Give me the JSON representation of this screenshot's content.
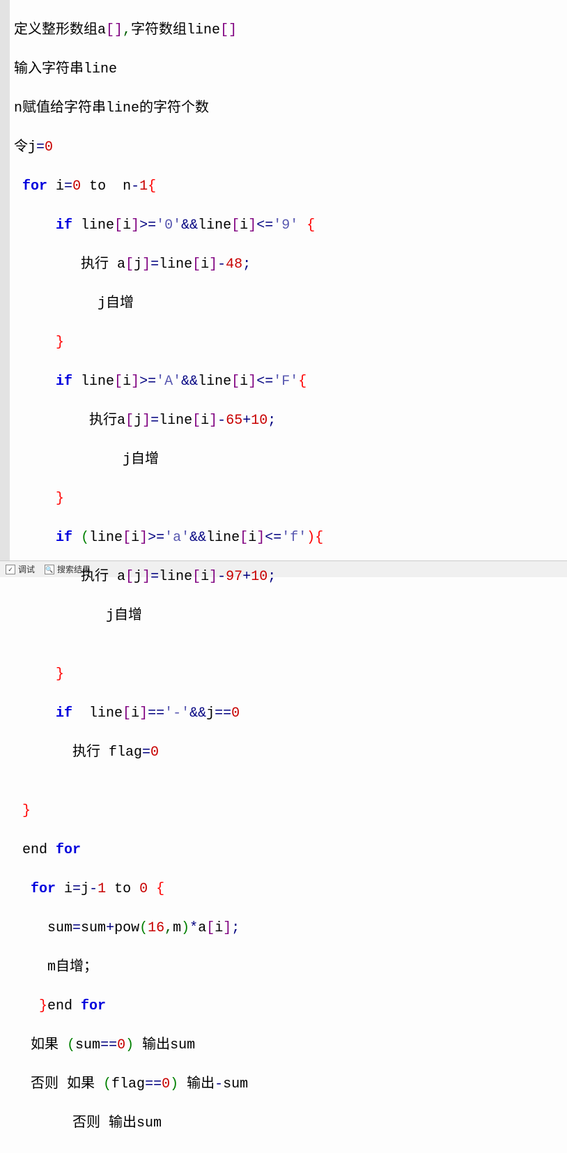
{
  "lines": {
    "l1": {
      "a": "定义整形数组a",
      "b": ",",
      "c": "字符数组line"
    },
    "l2": {
      "a": "输入字符串line"
    },
    "l3": {
      "a": "n赋值给字符串line的字符个数"
    },
    "l4": {
      "a": "令j",
      "b": "=",
      "c": "0"
    },
    "l5": {
      "a": "for",
      "b": " i",
      "c": "=",
      "d": "0",
      "e": " to  n",
      "f": "-",
      "g": "1",
      "h": "{"
    },
    "l6": {
      "a": "if",
      "b": " line",
      "c": "[",
      "d": "i",
      "e": "]",
      "f": ">=",
      "g": "'0'",
      "h": "&&",
      "i": "line",
      "j": "[",
      "k": "i",
      "l": "]",
      "m": "<=",
      "n": "'9'",
      "o": " {"
    },
    "l7": {
      "a": "执行 a",
      "b": "[",
      "c": "j",
      "d": "]",
      "e": "=",
      "f": "line",
      "g": "[",
      "h": "i",
      "i": "]",
      "j": "-",
      "k": "48",
      "l": ";"
    },
    "l8": {
      "a": "j自增"
    },
    "l9": {
      "a": "}"
    },
    "l10": {
      "a": "if",
      "b": " line",
      "c": "[",
      "d": "i",
      "e": "]",
      "f": ">=",
      "g": "'A'",
      "h": "&&",
      "i": "line",
      "j": "[",
      "k": "i",
      "l": "]",
      "m": "<=",
      "n": "'F'",
      "o": "{"
    },
    "l11": {
      "a": "执行a",
      "b": "[",
      "c": "j",
      "d": "]",
      "e": "=",
      "f": "line",
      "g": "[",
      "h": "i",
      "i": "]",
      "j": "-",
      "k": "65",
      "l": "+",
      "m": "10",
      "n": ";"
    },
    "l12": {
      "a": "j自增"
    },
    "l13": {
      "a": "}"
    },
    "l14": {
      "a": "if",
      "b": " (",
      "c": "line",
      "d": "[",
      "e": "i",
      "f": "]",
      "g": ">=",
      "h": "'a'",
      "i": "&&",
      "j": "line",
      "k": "[",
      "l": "i",
      "m": "]",
      "n": "<=",
      "o": "'f'",
      "p": "){"
    },
    "l15": {
      "a": "执行 a",
      "b": "[",
      "c": "j",
      "d": "]",
      "e": "=",
      "f": "line",
      "g": "[",
      "h": "i",
      "i": "]",
      "j": "-",
      "k": "97",
      "l": "+",
      "m": "10",
      "n": ";"
    },
    "l16": {
      "a": "j自增"
    },
    "l17": {
      "a": ""
    },
    "l18": {
      "a": "}"
    },
    "l19": {
      "a": "if",
      "b": "  line",
      "c": "[",
      "d": "i",
      "e": "]",
      "f": "==",
      "g": "'-'",
      "h": "&&",
      "i": "j",
      "j": "==",
      "k": "0"
    },
    "l20": {
      "a": "执行 flag",
      "b": "=",
      "c": "0"
    },
    "l21": {
      "a": ""
    },
    "l22": {
      "a": "}"
    },
    "l23": {
      "a": "end ",
      "b": "for"
    },
    "l24": {
      "a": "for",
      "b": " i",
      "c": "=",
      "d": "j",
      "e": "-",
      "f": "1",
      "g": " to ",
      "h": "0",
      "i": " {"
    },
    "l25": {
      "a": "sum",
      "b": "=",
      "c": "sum",
      "d": "+",
      "e": "pow",
      "f": "(",
      "g": "16",
      "h": ",",
      "i": "m",
      "j": ")",
      "k": "*",
      "l": "a",
      "m": "[",
      "n": "i",
      "o": "]",
      "p": ";"
    },
    "l26": {
      "a": "m自增；"
    },
    "l27": {
      "a": "}",
      "b": "end ",
      "c": "for"
    },
    "l28": {
      "a": "如果 ",
      "b": "(",
      "c": "sum",
      "d": "==",
      "e": "0",
      "f": ")",
      "g": " 输出sum"
    },
    "l29": {
      "a": "否则 如果 ",
      "b": "(",
      "c": "flag",
      "d": "==",
      "e": "0",
      "f": ")",
      "g": " 输出",
      "h": "-",
      "i": "sum"
    },
    "l30": {
      "a": "否则 输出sum"
    }
  },
  "footer": {
    "tab1": "调试",
    "tab2": "搜索结果"
  }
}
